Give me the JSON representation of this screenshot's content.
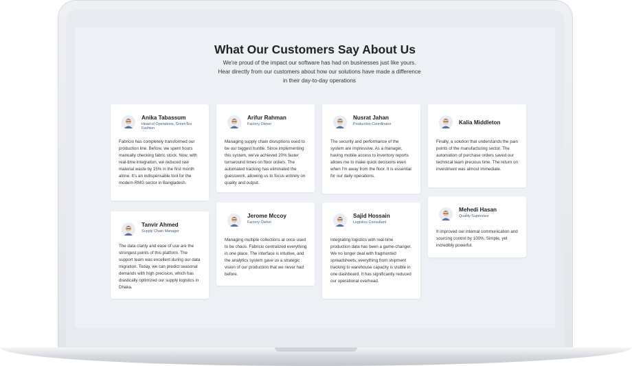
{
  "header": {
    "title": "What Our Customers Say About Us",
    "subtitle": "We're proud of the impact our software has had on businesses just like yours. Hear directly from our customers about how our solutions have made a difference in their day-to-day operations"
  },
  "testimonials": [
    {
      "name": "Anika Tabassum",
      "role": "Head of Operations, GreenTex Fashion",
      "text": "Fabricio has completely transformed our production line. Before, we spent hours manually checking fabric stock. Now, with real-time integration, we reduced raw material waste by 15% in the first month alone. It's an indispensable tool for the modern RMG sector in Bangladesh."
    },
    {
      "name": "Arifur Rahman",
      "role": "Factory Owner",
      "text": "Managing supply chain disruptions used to be our biggest hurdle. Since implementing this system, we've achieved 20% faster turnaround times on floor orders. The automated tracking has eliminated the guesswork, allowing us to focus entirely on quality and output."
    },
    {
      "name": "Nusrat Jahan",
      "role": "Production Coordinator",
      "text": "The security and performance of the system are impressive. As a manager, having mobile access to inventory reports allows me to make quick decisions even when I'm away from the floor. It is essential for our daily operations."
    },
    {
      "name": "Kalia Middleton",
      "role": "",
      "text": "Finally, a solution that understands the pain points of the manufacturing sector. The automation of purchase orders saved our technical team precious time. The return on investment was almost immediate."
    },
    {
      "name": "Tanvir Ahmed",
      "role": "Supply Chain Manager",
      "text": "The data clarity and ease of use are the strongest points of this platform. The support team was excellent during our data migration. Today, we can predict seasonal demands with high precision, which has drastically optimized our supply logistics in Dhaka."
    },
    {
      "name": "Jerome Mccoy",
      "role": "Factory Owner",
      "text": "Managing multiple collections at once used to be chaos. Fabricio centralized everything in one place. The interface is intuitive, and the analytics system gave us a strategic vision of our production that we never had before."
    },
    {
      "name": "Sajid Hossain",
      "role": "Logistics Consultant",
      "text": "Integrating logistics with real-time production data has been a game-changer. We no longer deal with fragmented spreadsheets; everything from shipment tracking to warehouse capacity is visible in one dashboard. It has significantly reduced our operational overhead."
    },
    {
      "name": "Mehedi Hasan",
      "role": "Quality Supervisor",
      "text": "It improved our internal communication and sourcing control by 100%. Simple, yet incredibly powerful."
    }
  ]
}
